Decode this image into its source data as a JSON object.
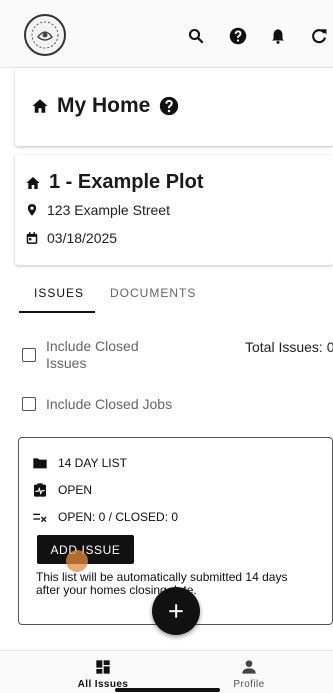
{
  "header": {
    "icons": [
      "logo-icon",
      "search-icon",
      "help-icon",
      "bell-icon",
      "refresh-icon"
    ]
  },
  "home_card": {
    "title": "My Home"
  },
  "plot_card": {
    "title": "1 - Example Plot",
    "address": "123 Example Street",
    "date": "03/18/2025"
  },
  "tabs": [
    {
      "label": "ISSUES",
      "active": true
    },
    {
      "label": "DOCUMENTS",
      "active": false
    }
  ],
  "filters": {
    "include_closed_issues": "Include Closed\nIssues",
    "include_closed_jobs": "Include Closed Jobs",
    "total_issues": "Total Issues: 0"
  },
  "list_card": {
    "name": "14 DAY LIST",
    "status": "OPEN",
    "counts": "OPEN: 0 / CLOSED: 0",
    "add_button": "ADD ISSUE",
    "note": "This list will be automatically submitted 14 days after your homes closing date."
  },
  "bottom_nav": {
    "all_issues": "All Issues",
    "profile": "Profile"
  },
  "colors": {
    "primary": "#111111",
    "ripple": "#e68c3c"
  }
}
